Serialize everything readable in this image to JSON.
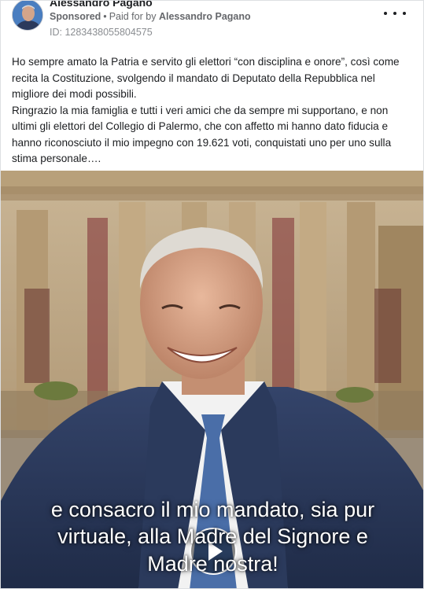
{
  "post": {
    "author": "Alessandro Pagano",
    "sponsored_label": "Sponsored",
    "separator": "•",
    "paid_for_prefix": "Paid for by",
    "paid_for_name": "Alessandro Pagano",
    "id_line": "ID: 1283438055804575",
    "text_lines": [
      "Ho sempre amato la Patria e servito gli elettori “con disciplina e onore”, così come recita la Costituzione, svolgendo il mandato di Deputato della Repubblica nel migliore dei modi possibili.",
      "Ringrazio la mia famiglia e tutti i veri amici che da sempre mi supportano, e non ultimi gli elettori del Collegio di Palermo, che con affetto mi hanno dato fiducia e hanno riconosciuto il mio impegno con 19.621 voti, conquistati uno per uno sulla stima personale…."
    ]
  },
  "video": {
    "caption_lines": [
      "e consacro il mio mandato, sia pur",
      "virtuale, alla Madre del Signore e",
      "Madre nostra!"
    ]
  },
  "icons": {
    "more": "more-options-icon",
    "play": "play-icon"
  },
  "colors": {
    "meta_gray": "#65676b",
    "id_gray": "#8a8d91",
    "suit": "#2b3a5c",
    "tie": "#4a6ea8"
  }
}
